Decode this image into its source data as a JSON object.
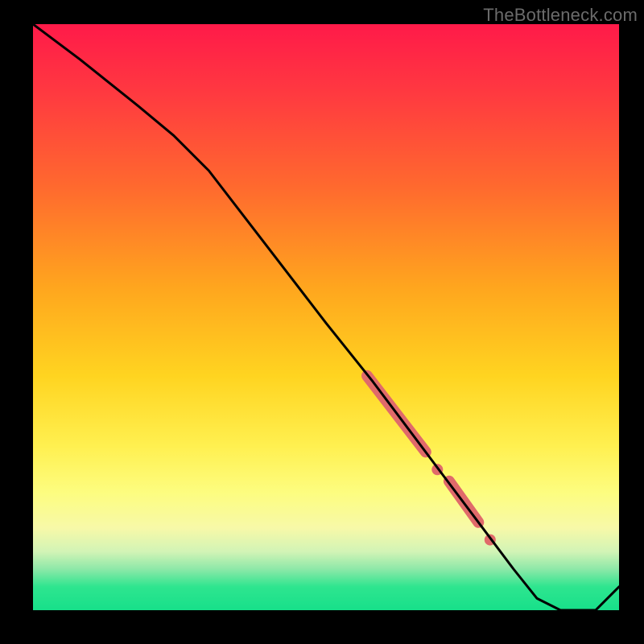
{
  "watermark": "TheBottleneck.com",
  "chart_data": {
    "type": "line",
    "title": "",
    "xlabel": "",
    "ylabel": "",
    "xlim": [
      0,
      100
    ],
    "ylim": [
      0,
      100
    ],
    "grid": false,
    "legend": false,
    "series": [
      {
        "name": "curve",
        "color": "#000000",
        "x": [
          0,
          8,
          18,
          24,
          30,
          40,
          50,
          58,
          64,
          70,
          76,
          82,
          86,
          90,
          96,
          100
        ],
        "y": [
          100,
          94,
          86,
          81,
          75,
          62,
          49,
          39,
          31,
          23,
          15,
          7,
          2,
          0,
          0,
          4
        ]
      }
    ],
    "highlights": [
      {
        "name": "segment-a",
        "color": "#e06a6a",
        "x": [
          57,
          67
        ],
        "y": [
          40,
          27
        ]
      },
      {
        "name": "dot-a",
        "color": "#e06a6a",
        "x": [
          69
        ],
        "y": [
          24
        ]
      },
      {
        "name": "segment-b",
        "color": "#e06a6a",
        "x": [
          71,
          76
        ],
        "y": [
          22,
          15
        ]
      },
      {
        "name": "dot-b",
        "color": "#e06a6a",
        "x": [
          78
        ],
        "y": [
          12
        ]
      }
    ]
  }
}
